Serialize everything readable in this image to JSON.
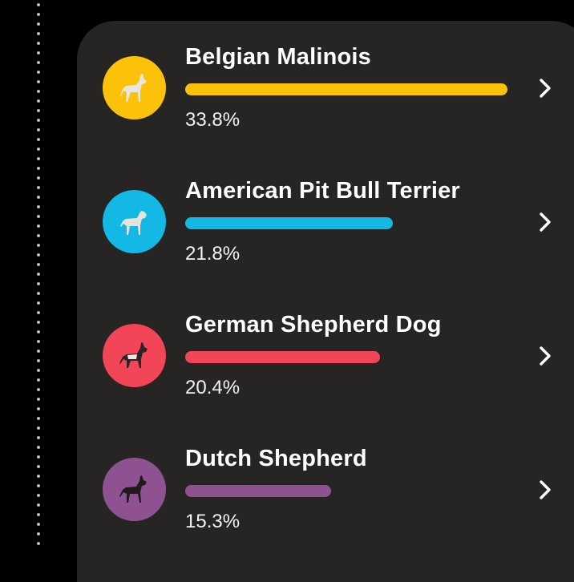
{
  "breeds": [
    {
      "name": "Belgian Malinois",
      "percent_label": "33.8%",
      "percent": 33.8,
      "color": "#fcc20a",
      "dog_color": "#e9e6df",
      "icon": "dog-icon"
    },
    {
      "name": "American Pit Bull Terrier",
      "percent_label": "21.8%",
      "percent": 21.8,
      "color": "#13b8e4",
      "dog_color": "#e6e3dc",
      "icon": "dog-icon"
    },
    {
      "name": "German Shepherd Dog",
      "percent_label": "20.4%",
      "percent": 20.4,
      "color": "#f24557",
      "dog_color": "#2a2526",
      "icon": "dog-icon"
    },
    {
      "name": "Dutch Shepherd",
      "percent_label": "15.3%",
      "percent": 15.3,
      "color": "#8f5290",
      "dog_color": "#1f1a1c",
      "icon": "dog-icon"
    }
  ],
  "chevron_icon": "chevron-right-icon"
}
